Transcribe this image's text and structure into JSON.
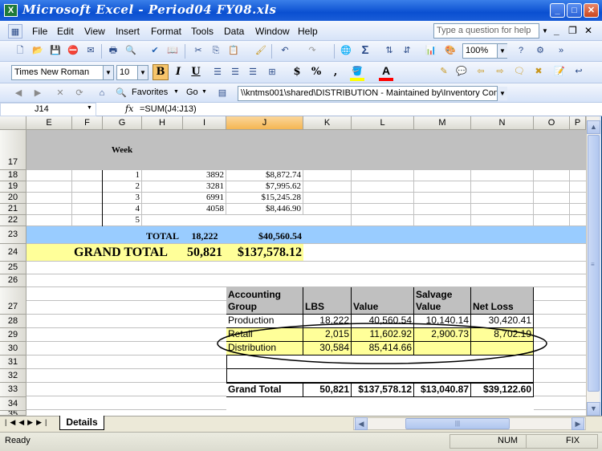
{
  "window": {
    "app_icon": "excel-icon",
    "title": "Microsoft Excel - Period04 FY08.xls",
    "min": "_",
    "max": "□",
    "close": "✕"
  },
  "menu": {
    "items": [
      "File",
      "Edit",
      "View",
      "Insert",
      "Format",
      "Tools",
      "Data",
      "Window",
      "Help"
    ],
    "help_placeholder": "Type a question for help",
    "doc_min": "_",
    "doc_restore": "❐",
    "doc_close": "✕"
  },
  "toolbar": {
    "zoom": "100%",
    "font_name": "Times New Roman",
    "font_size": "10",
    "bold": "B",
    "italic": "I",
    "underline": "U",
    "currency": "$",
    "percent": "%",
    "comma": ",",
    "favorites": "Favorites",
    "go": "Go",
    "address": "\\\\kntms001\\shared\\DISTRIBUTION - Maintained by\\Inventory Cont",
    "sigma": "Σ",
    "fill_color": "#ffff00",
    "font_color": "#ff0000"
  },
  "formula_bar": {
    "name_box": "J14",
    "fx": "fx",
    "formula": "=SUM(J4:J13)"
  },
  "grid": {
    "columns": [
      "E",
      "F",
      "G",
      "H",
      "I",
      "J",
      "K",
      "L",
      "M",
      "N",
      "O",
      "P"
    ],
    "selected_column": "J",
    "rows": [
      "17",
      "18",
      "19",
      "20",
      "21",
      "22",
      "23",
      "24",
      "25",
      "26",
      "27",
      "28",
      "29",
      "30",
      "31",
      "32",
      "33",
      "34",
      "35"
    ],
    "week_header": "Week",
    "weekly": [
      {
        "week": "1",
        "lbs": "3892",
        "value": "$8,872.74"
      },
      {
        "week": "2",
        "lbs": "3281",
        "value": "$7,995.62"
      },
      {
        "week": "3",
        "lbs": "6991",
        "value": "$15,245.28"
      },
      {
        "week": "4",
        "lbs": "4058",
        "value": "$8,446.90"
      },
      {
        "week": "5",
        "lbs": "",
        "value": ""
      }
    ],
    "total": {
      "label": "TOTAL",
      "lbs": "18,222",
      "value": "$40,560.54"
    },
    "grand_total": {
      "label": "GRAND TOTAL",
      "lbs": "50,821",
      "value": "$137,578.12"
    },
    "summary": {
      "headers": {
        "group_line1": "Accounting",
        "group_line2": "Group",
        "lbs": "LBS",
        "value": "Value",
        "salvage_line1": "Salvage",
        "salvage_line2": "Value",
        "net_loss": "Net Loss"
      },
      "rows": [
        {
          "group": "Production",
          "lbs": "18,222",
          "value": "40,560.54",
          "salvage": "10,140.14",
          "net_loss": "30,420.41"
        },
        {
          "group": "Retail",
          "lbs": "2,015",
          "value": "11,602.92",
          "salvage": "2,900.73",
          "net_loss": "8,702.19"
        },
        {
          "group": "Distribution",
          "lbs": "30,584",
          "value": "85,414.66",
          "salvage": "",
          "net_loss": ""
        }
      ],
      "grand_total": {
        "label": "Grand Total",
        "lbs": "50,821",
        "value": "$137,578.12",
        "salvage": "$13,040.87",
        "net_loss": "$39,122.60"
      }
    }
  },
  "sheet_tabs": {
    "active": "Details"
  },
  "status": {
    "left": "Ready",
    "num": "NUM",
    "fix": "FIX"
  },
  "colors": {
    "total_row": "#99ccff",
    "grand_total_row": "#ffff99",
    "summary_header": "#c0c0c0",
    "title_bar": "#0a4fd1"
  }
}
